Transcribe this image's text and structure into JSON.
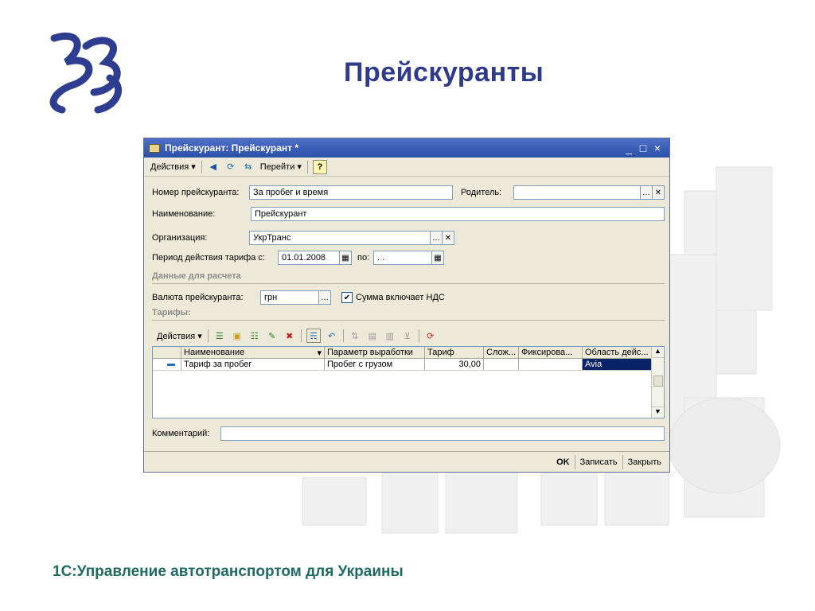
{
  "slide": {
    "title": "Прейскуранты",
    "footer": "1С:Управление автотранспортом для Украины"
  },
  "window": {
    "title": "Прейскурант: Прейскурант *",
    "controls": [
      "_",
      "□",
      "×"
    ],
    "toolbar": {
      "actions_label": "Действия ▾",
      "goto_label": "Перейти ▾",
      "help_label": "?"
    }
  },
  "form": {
    "number_label": "Номер прейскуранта:",
    "number_value": "За пробег и время",
    "parent_label": "Родитель:",
    "parent_value": "",
    "name_label": "Наименование:",
    "name_value": "Прейскурант",
    "org_label": "Организация:",
    "org_value": "УкрТранс",
    "period_label": "Период действия тарифа с:",
    "period_from": "01.01.2008",
    "period_to_label": "по:",
    "period_to": " .  .",
    "section_calc": "Данные для расчета",
    "currency_label": "Валюта прейскуранта:",
    "currency_value": "грн",
    "vat_checked": true,
    "vat_label": "Сумма включает НДС",
    "section_tariffs": "Тарифы:",
    "tariff_actions": "Действия ▾",
    "comment_label": "Комментарий:",
    "comment_value": ""
  },
  "grid": {
    "columns": [
      "Наименование",
      "Параметр выработки",
      "Тариф",
      "Слож...",
      "Фиксирова...",
      "Область дейс..."
    ],
    "rows": [
      {
        "name": "Тариф за пробег",
        "param": "Пробег с грузом",
        "tariff": "30,00",
        "slozh": "",
        "fixed": "",
        "area": "Avia"
      }
    ]
  },
  "buttons": {
    "ok": "OK",
    "save": "Записать",
    "close": "Закрыть"
  },
  "colors": {
    "title": "#2f3a88",
    "footer": "#1f6b63",
    "titlebar": "#2b4fa8"
  }
}
